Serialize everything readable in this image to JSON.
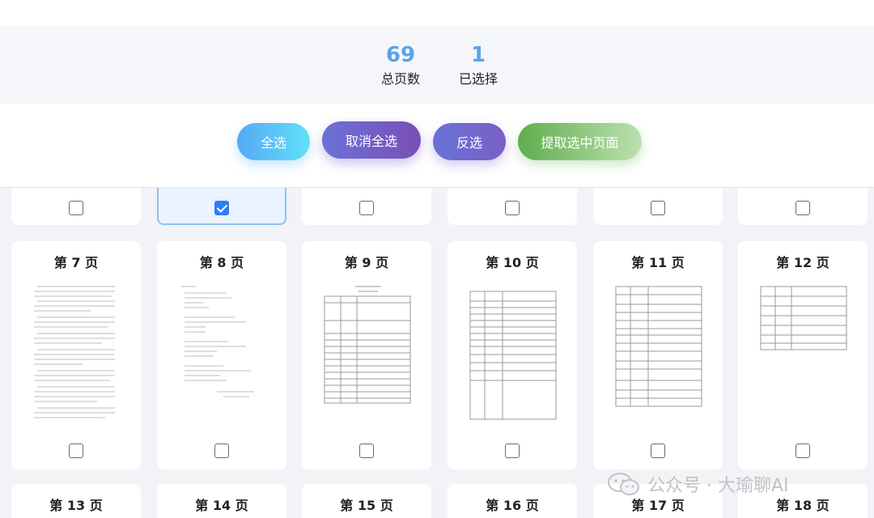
{
  "stats": {
    "total_value": "69",
    "total_label": "总页数",
    "selected_value": "1",
    "selected_label": "已选择"
  },
  "toolbar": {
    "select_all": "全选",
    "deselect_all": "取消全选",
    "invert": "反选",
    "extract": "提取选中页面"
  },
  "pages": {
    "p7": "第 7 页",
    "p8": "第 8 页",
    "p9": "第 9 页",
    "p10": "第 10 页",
    "p11": "第 11 页",
    "p12": "第 12 页",
    "p13": "第 13 页",
    "p14": "第 14 页",
    "p15": "第 15 页",
    "p16": "第 16 页",
    "p17": "第 17 页",
    "p18": "第 18 页"
  },
  "selection": {
    "row1": [
      false,
      true,
      false,
      false,
      false,
      false
    ],
    "row2": [
      false,
      false,
      false,
      false,
      false,
      false
    ]
  },
  "watermark": {
    "text": "公众号 · 大瑜聊AI",
    "icon": "wechat-icon"
  }
}
